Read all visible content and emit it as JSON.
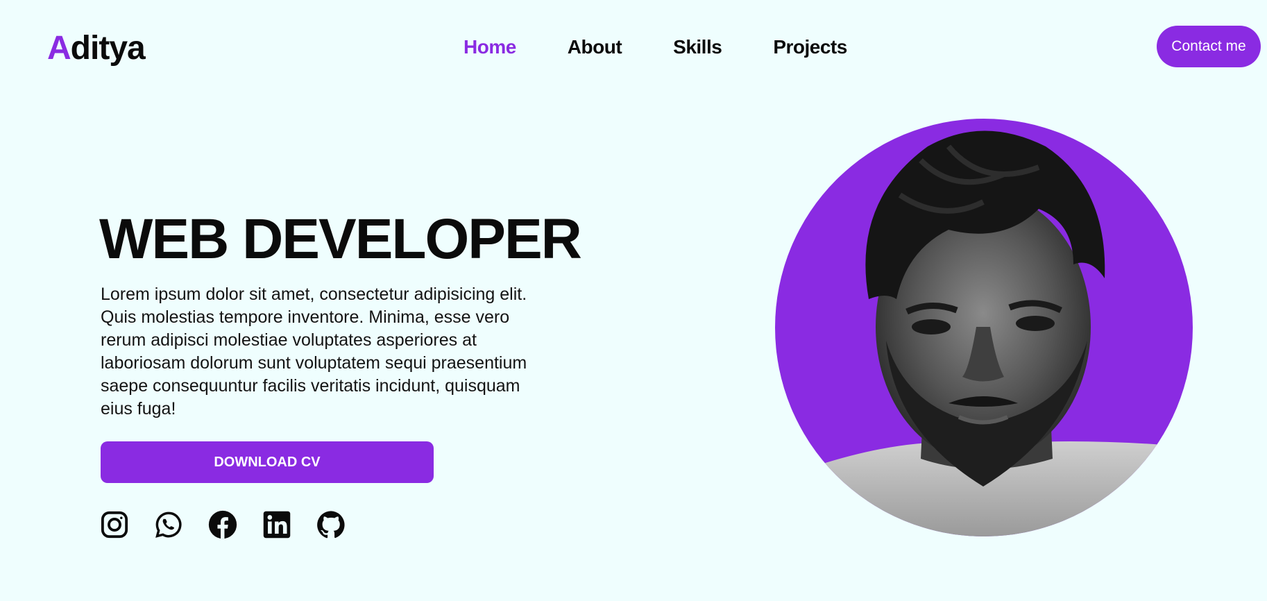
{
  "header": {
    "logo_initial": "A",
    "logo_rest": "ditya",
    "nav": [
      {
        "label": "Home",
        "active": true
      },
      {
        "label": "About",
        "active": false
      },
      {
        "label": "Skills",
        "active": false
      },
      {
        "label": "Projects",
        "active": false
      }
    ],
    "contact_label": "Contact me"
  },
  "hero": {
    "title": "WEB DEVELOPER",
    "description": "Lorem ipsum dolor sit amet, consectetur adipisicing elit. Quis molestias tempore inventore. Minima, esse vero rerum adipisci molestiae voluptates asperiores at laboriosam dolorum sunt voluptatem sequi praesentium saepe consequuntur facilis veritatis incidunt, quisquam eius fuga!",
    "cta_label": "DOWNLOAD CV"
  },
  "socials": [
    "instagram-icon",
    "whatsapp-icon",
    "facebook-icon",
    "linkedin-icon",
    "github-icon"
  ],
  "colors": {
    "accent": "#8a2be2",
    "background": "#effefe",
    "text": "#0b0b0b"
  }
}
